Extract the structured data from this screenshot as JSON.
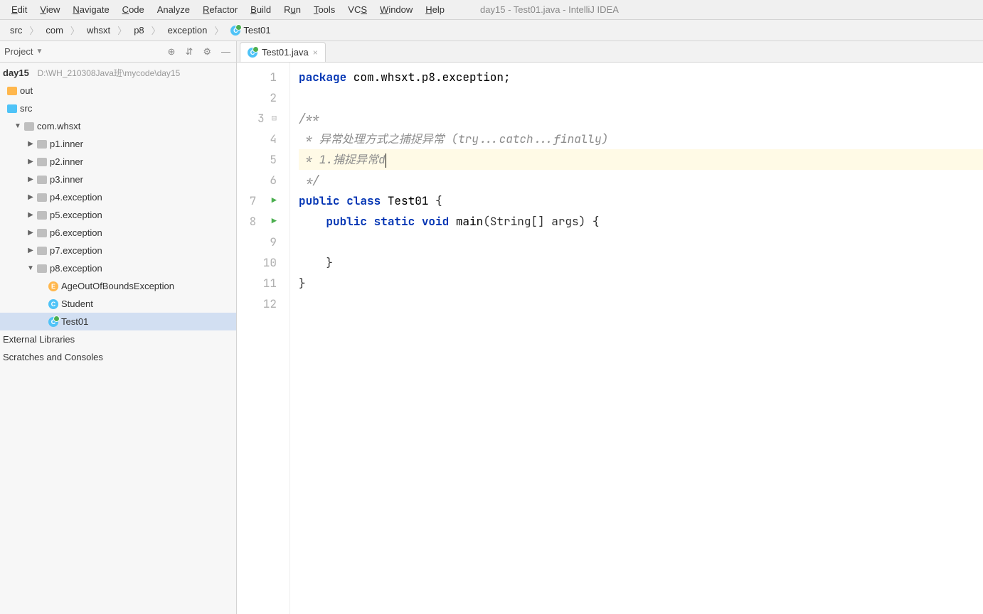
{
  "window_title": "day15 - Test01.java - IntelliJ IDEA",
  "menu": [
    "Edit",
    "View",
    "Navigate",
    "Code",
    "Analyze",
    "Refactor",
    "Build",
    "Run",
    "Tools",
    "VCS",
    "Window",
    "Help"
  ],
  "breadcrumbs": [
    "src",
    "com",
    "whsxt",
    "p8",
    "exception",
    "Test01"
  ],
  "sidebar": {
    "title": "Project",
    "project_name": "day15",
    "project_path": "D:\\WH_210308Java班\\mycode\\day15",
    "out": "out",
    "src": "src",
    "pkg_root": "com.whsxt",
    "packages": [
      "p1.inner",
      "p2.inner",
      "p3.inner",
      "p4.exception",
      "p5.exception",
      "p6.exception",
      "p7.exception",
      "p8.exception"
    ],
    "p8_files": [
      "AgeOutOfBoundsException",
      "Student",
      "Test01"
    ],
    "ext_lib": "External Libraries",
    "scratches": "Scratches and Consoles"
  },
  "tab": {
    "label": "Test01.java"
  },
  "code": {
    "lines": [
      "1",
      "2",
      "3",
      "4",
      "5",
      "6",
      "7",
      "8",
      "9",
      "10",
      "11",
      "12"
    ],
    "l1_kw": "package",
    "l1_rest": " com.whsxt.p8.exception;",
    "l3": "/**",
    "l4": " * 异常处理方式之捕捉异常 (try...catch...finally)",
    "l5": " * 1.捕捉异常d",
    "l6": " */",
    "l7_pub": "public",
    "l7_class": " class ",
    "l7_name": "Test01",
    "l7_brace": " {",
    "l8_pub": "    public",
    "l8_static": " static",
    "l8_void": " void ",
    "l8_main": "main",
    "l8_args": "(String[] args) {",
    "l10": "    }",
    "l11": "}"
  }
}
